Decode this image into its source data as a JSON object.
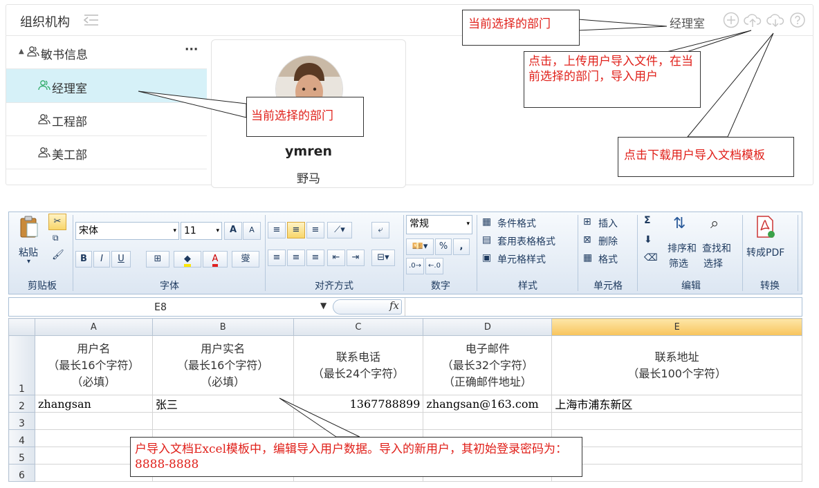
{
  "org": {
    "title": "组织机构",
    "current_dept": "经理室",
    "tree": [
      {
        "label": "敏书信息",
        "more": "···"
      },
      {
        "label": "经理室"
      },
      {
        "label": "工程部"
      },
      {
        "label": "美工部"
      }
    ],
    "user_card": {
      "name": "ymren",
      "realname": "野马"
    }
  },
  "callouts": {
    "current_dept_top": "当前选择的部门",
    "upload": "点击，上传用户导入文件，在当前选择的部门，导入用户",
    "current_dept_tree": "当前选择的部门",
    "download": "点击下载用户导入文档模板",
    "excel": "户导入文档Excel模板中，编辑导入用户数据。导入的新用户，其初始登录密码为：8888-8888"
  },
  "ribbon": {
    "paste": "粘贴",
    "font_name": "宋体",
    "font_size": "11",
    "grow_font": "A",
    "shrink_font": "A",
    "bold": "B",
    "italic": "I",
    "underline": "U",
    "phonetic": "燮",
    "number_format": "常规",
    "percent": "%",
    "comma": ",",
    "cond_format": "条件格式",
    "table_format": "套用表格格式",
    "cell_style": "单元格样式",
    "insert": "插入",
    "delete": "删除",
    "format": "格式",
    "sigma": "Σ",
    "sort_filter_1": "排序和",
    "sort_filter_2": "筛选",
    "find_select_1": "查找和",
    "find_select_2": "选择",
    "to_pdf": "转成PDF",
    "groups": [
      "剪贴板",
      "字体",
      "对齐方式",
      "数字",
      "样式",
      "单元格",
      "编辑",
      "转换"
    ]
  },
  "formula_bar": {
    "name_box": "E8",
    "fx": "fx"
  },
  "sheet": {
    "columns": [
      "A",
      "B",
      "C",
      "D",
      "E"
    ],
    "rows": [
      "1",
      "2",
      "3",
      "4",
      "5",
      "6"
    ],
    "headers": [
      {
        "l1": "用户名",
        "l2": "（最长16个字符）",
        "l3": "（必填）"
      },
      {
        "l1": "用户实名",
        "l2": "（最长16个字符）",
        "l3": "（必填）"
      },
      {
        "l1": "联系电话",
        "l2": "（最长24个字符）",
        "l3": ""
      },
      {
        "l1": "电子邮件",
        "l2": "（最长32个字符）",
        "l3": "（正确邮件地址）"
      },
      {
        "l1": "联系地址",
        "l2": "（最长100个字符）",
        "l3": ""
      }
    ],
    "row2": [
      "zhangsan",
      "张三",
      "1367788899",
      "zhangsan@163.com",
      "上海市浦东新区"
    ]
  }
}
